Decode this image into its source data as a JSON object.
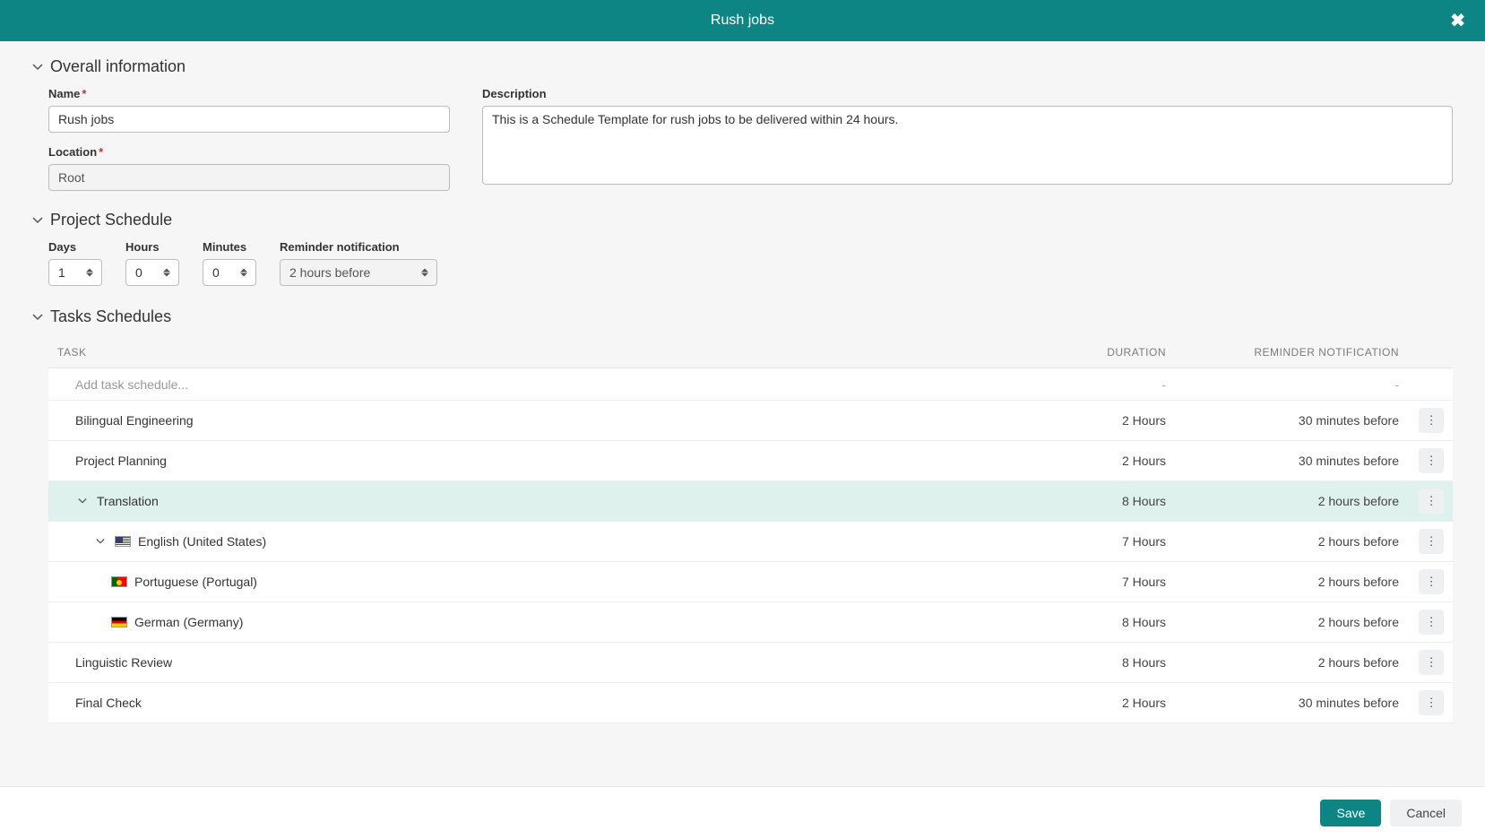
{
  "modal": {
    "title": "Rush jobs"
  },
  "overall": {
    "section_title": "Overall information",
    "name_label": "Name",
    "name_value": "Rush jobs",
    "location_label": "Location",
    "location_value": "Root",
    "description_label": "Description",
    "description_value": "This is a Schedule Template for rush jobs to be delivered within 24 hours."
  },
  "schedule": {
    "section_title": "Project Schedule",
    "days_label": "Days",
    "days_value": "1",
    "hours_label": "Hours",
    "hours_value": "0",
    "minutes_label": "Minutes",
    "minutes_value": "0",
    "reminder_label": "Reminder notification",
    "reminder_value": "2 hours before"
  },
  "tasks": {
    "section_title": "Tasks Schedules",
    "headers": {
      "task": "TASK",
      "duration": "DURATION",
      "reminder": "REMINDER NOTIFICATION"
    },
    "add_placeholder": "Add task schedule...",
    "rows": [
      {
        "name": "Bilingual Engineering",
        "duration": "2 Hours",
        "reminder": "30 minutes before",
        "indent": 0,
        "expandable": false,
        "selected": false,
        "flag": null
      },
      {
        "name": "Project Planning",
        "duration": "2 Hours",
        "reminder": "30 minutes before",
        "indent": 0,
        "expandable": false,
        "selected": false,
        "flag": null
      },
      {
        "name": "Translation",
        "duration": "8 Hours",
        "reminder": "2 hours before",
        "indent": 0,
        "expandable": true,
        "expanded": true,
        "selected": true,
        "flag": null
      },
      {
        "name": "English (United States)",
        "duration": "7 Hours",
        "reminder": "2 hours before",
        "indent": 1,
        "expandable": true,
        "expanded": true,
        "selected": false,
        "flag": "us"
      },
      {
        "name": "Portuguese (Portugal)",
        "duration": "7 Hours",
        "reminder": "2 hours before",
        "indent": 2,
        "expandable": false,
        "selected": false,
        "flag": "pt"
      },
      {
        "name": "German (Germany)",
        "duration": "8 Hours",
        "reminder": "2 hours before",
        "indent": 2,
        "expandable": false,
        "selected": false,
        "flag": "de"
      },
      {
        "name": "Linguistic Review",
        "duration": "8 Hours",
        "reminder": "2 hours before",
        "indent": 0,
        "expandable": false,
        "selected": false,
        "flag": null
      },
      {
        "name": "Final Check",
        "duration": "2 Hours",
        "reminder": "30 minutes before",
        "indent": 0,
        "expandable": false,
        "selected": false,
        "flag": null
      }
    ]
  },
  "footer": {
    "save": "Save",
    "cancel": "Cancel"
  }
}
